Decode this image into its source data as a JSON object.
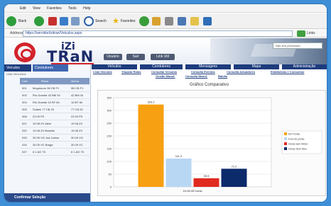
{
  "browser": {
    "menu": [
      "Edit",
      "View",
      "Favorites",
      "Tools",
      "Help"
    ],
    "back_label": "Back",
    "search_label": "Search",
    "favorites_label": "Favorites",
    "address_label": "Address",
    "url": "https://servidor/izitran/Veiculos.aspx",
    "go_label": "Links"
  },
  "header": {
    "logo_izi": "iZi",
    "logo_tran": "TRaN",
    "buttons": [
      "Usuário",
      "Sair",
      "Link Util"
    ],
    "search_placeholder": "Não tem permissão"
  },
  "left": {
    "tabs": [
      "Veículos",
      "Condutores"
    ],
    "breadcrumb": "Lista Veículos ▸",
    "columns": [
      "Cód",
      "Placa",
      "Marca"
    ],
    "rows": [
      [
        "001",
        "Mogotourn 96 CB F1",
        "9B CB F1"
      ],
      [
        "003",
        "Rio Grande 42 BM 34",
        "42 BM 34"
      ],
      [
        "004",
        "Rio Grande 10 BT 84",
        "10 BT 84"
      ],
      [
        "005",
        "Solaris 77 CB 20",
        "77 CB 20"
      ],
      [
        "008",
        "23 09 P9",
        "23 09 P9"
      ],
      [
        "021",
        "19 08 ZV Além",
        "19 08 ZV"
      ],
      [
        "032",
        "19 08 ZV Brasília",
        "19 08 ZV"
      ],
      [
        "033",
        "30 09 VG Joá Carlos",
        "30 09 VG"
      ],
      [
        "034",
        "30 09 VC Braga",
        "30 09 VC"
      ],
      [
        "037",
        "6 1 AG 75",
        "6 1 AG 75"
      ]
    ],
    "footer": "Confirmar Seleção"
  },
  "main": {
    "tabs": [
      "Veículos",
      "Condutores",
      "Mensagens",
      "Mapa",
      "Administração"
    ],
    "submenu": [
      "Lista Veículos",
      "Traçado Rotas",
      "Consultar Veículos",
      "Consulta Eventos",
      "Consulta Actuadores",
      "Estatísticas e Consumos",
      "Gestão Manut.",
      "Consulta Manut.",
      "Balcão"
    ]
  },
  "chart_data": {
    "type": "bar",
    "title": "Gráfico Comparativo",
    "categories": [
      "16-08-08 horas"
    ],
    "series": [
      {
        "name": "Em Ponta",
        "value": 323.2,
        "color": "#f7a011"
      },
      {
        "name": "Fora de ponta",
        "value": 111.2,
        "color": "#b8d7f3"
      },
      {
        "name": "Horas sem Motor",
        "value": 33.9,
        "color": "#e02a20"
      },
      {
        "name": "Horas Sem Mov.",
        "value": 71.2,
        "color": "#0c2b6b"
      }
    ],
    "value_labels": [
      "323.2",
      "111.2",
      "33.9",
      "71.2"
    ],
    "yticks": [
      "0",
      "50",
      "100",
      "150",
      "200",
      "250",
      "300",
      "350"
    ],
    "ylim": [
      0,
      350
    ]
  }
}
